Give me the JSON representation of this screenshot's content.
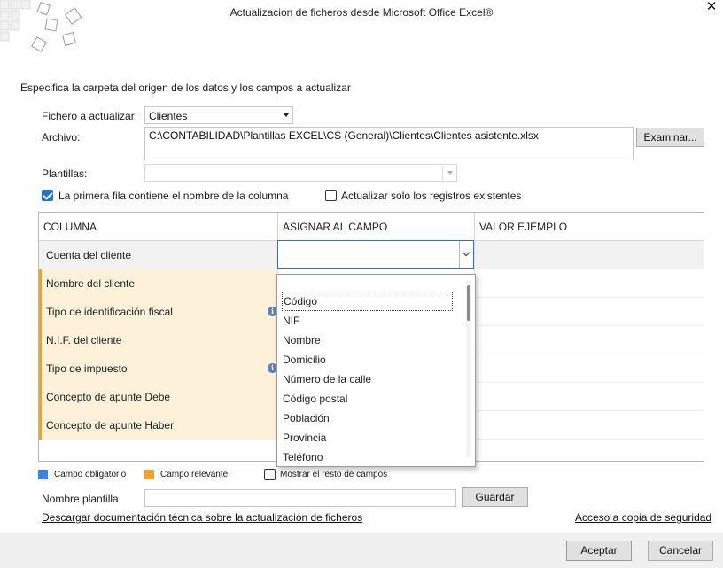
{
  "window": {
    "title": "Actualizacion de ficheros desde Microsoft Office Excel®",
    "close_label": "✕"
  },
  "instructions": "Especifica la carpeta del origen de los datos y los campos a actualizar",
  "form": {
    "fichero_label": "Fichero a actualizar:",
    "fichero_value": "Clientes",
    "archivo_label": "Archivo:",
    "archivo_value": "C:\\CONTABILIDAD\\Plantillas EXCEL\\CS (General)\\Clientes\\Clientes asistente.xlsx",
    "examinar_label": "Examinar...",
    "plantillas_label": "Plantillas:",
    "plantillas_value": "",
    "check_first_row_label": "La primera fila contiene el nombre de la columna",
    "check_first_row_checked": true,
    "check_update_only_label": "Actualizar solo los registros existentes",
    "check_update_only_checked": false
  },
  "grid": {
    "headers": [
      "COLUMNA",
      "ASIGNAR AL CAMPO",
      "VALOR EJEMPLO"
    ],
    "rows": [
      {
        "column": "Cuenta del cliente",
        "relevant": false,
        "info": false
      },
      {
        "column": "Nombre del cliente",
        "relevant": true,
        "info": false
      },
      {
        "column": "Tipo de identificación fiscal",
        "relevant": true,
        "info": true
      },
      {
        "column": "N.I.F. del cliente",
        "relevant": true,
        "info": false
      },
      {
        "column": "Tipo de impuesto",
        "relevant": true,
        "info": true
      },
      {
        "column": "Concepto de apunte Debe",
        "relevant": true,
        "info": false
      },
      {
        "column": "Concepto de apunte Haber",
        "relevant": true,
        "info": false
      }
    ],
    "assign_value": "",
    "info_glyph": "i"
  },
  "dropdown": {
    "options": [
      "",
      "Código",
      "NIF",
      "Nombre",
      "Domicilio",
      "Número de la calle",
      "Código postal",
      "Población",
      "Provincia",
      "Teléfono"
    ],
    "focused_index": 1
  },
  "legend": {
    "mandatory_label": "Campo obligatorio",
    "mandatory_color": "#3b82e6",
    "relevant_label": "Campo relevante",
    "relevant_color": "#f0a22b",
    "show_rest_label": "Mostrar el resto de campos",
    "show_rest_checked": false
  },
  "template": {
    "name_label": "Nombre plantilla:",
    "name_value": "",
    "save_label": "Guardar"
  },
  "links": {
    "docs": "Descargar documentación técnica sobre la actualización de ficheros",
    "backup": "Acceso a copia de seguridad"
  },
  "footer": {
    "accept_label": "Aceptar",
    "cancel_label": "Cancelar"
  }
}
